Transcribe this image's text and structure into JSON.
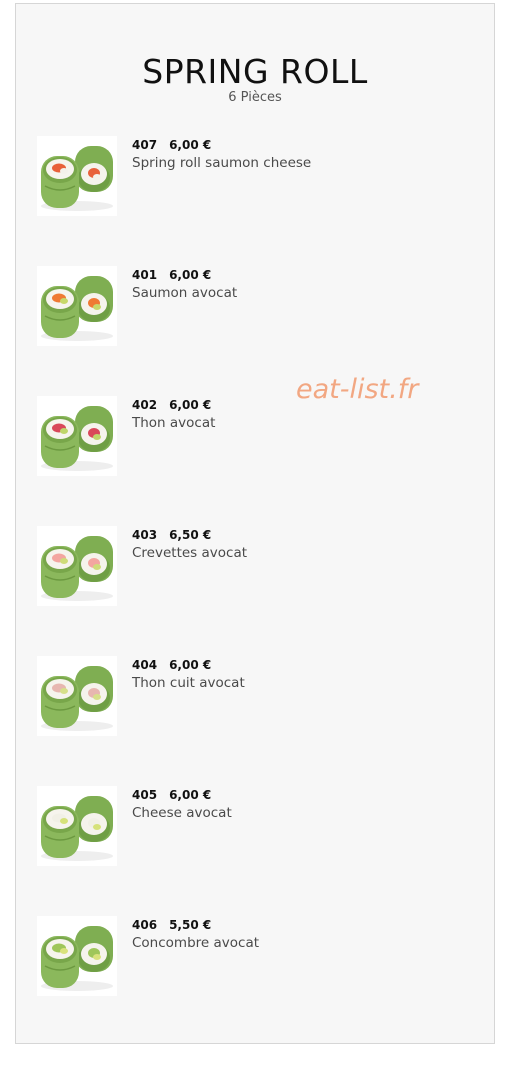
{
  "header": {
    "title": "SPRING ROLL",
    "subtitle": "6 Pièces"
  },
  "watermark": "eat-list.fr",
  "items": [
    {
      "code": "407",
      "price": "6,00 €",
      "name": "Spring roll saumon cheese",
      "fillings": [
        "#e8613a",
        "#f4f1ea"
      ]
    },
    {
      "code": "401",
      "price": "6,00 €",
      "name": "Saumon avocat",
      "fillings": [
        "#ef7a33",
        "#c7d86a"
      ]
    },
    {
      "code": "402",
      "price": "6,00 €",
      "name": "Thon avocat",
      "fillings": [
        "#d9485a",
        "#bfd56a"
      ]
    },
    {
      "code": "403",
      "price": "6,50 €",
      "name": "Crevettes avocat",
      "fillings": [
        "#f3a6a0",
        "#cfdc7a"
      ]
    },
    {
      "code": "404",
      "price": "6,00 €",
      "name": "Thon cuit avocat",
      "fillings": [
        "#e7b7b0",
        "#d7e08a"
      ]
    },
    {
      "code": "405",
      "price": "6,00 €",
      "name": "Cheese avocat",
      "fillings": [
        "#f1f0e6",
        "#d6e27a"
      ]
    },
    {
      "code": "406",
      "price": "5,50 €",
      "name": "Concombre avocat",
      "fillings": [
        "#9fc65a",
        "#d9e27c"
      ]
    }
  ]
}
